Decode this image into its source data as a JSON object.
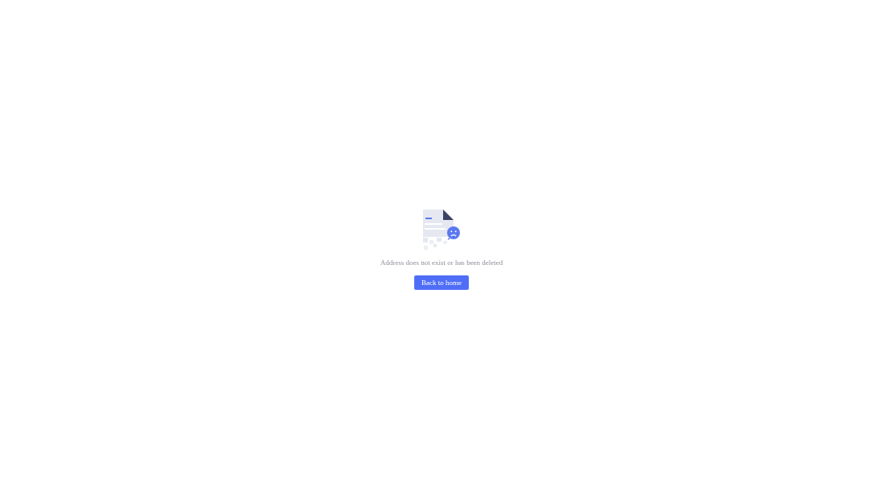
{
  "message": "Address does not exist or has been deleted",
  "button": {
    "label": "Back to home"
  }
}
